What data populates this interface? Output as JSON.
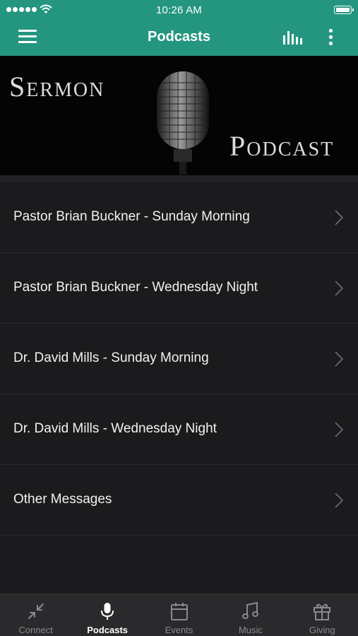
{
  "status": {
    "time": "10:26 AM"
  },
  "nav": {
    "title": "Podcasts",
    "menu_icon": "hamburger-menu-icon",
    "equalizer_icon": "equalizer-icon",
    "more_icon": "more-vertical-icon"
  },
  "banner": {
    "line1": "Sermon",
    "line2": "Podcast",
    "icon": "microphone-icon"
  },
  "podcasts": [
    {
      "label": "Pastor Brian Buckner - Sunday Morning"
    },
    {
      "label": "Pastor Brian Buckner - Wednesday Night"
    },
    {
      "label": "Dr. David Mills - Sunday Morning"
    },
    {
      "label": "Dr. David Mills - Wednesday Night"
    },
    {
      "label": "Other Messages"
    }
  ],
  "tabs": [
    {
      "label": "Connect",
      "icon": "arrows-collapse-icon",
      "active": false
    },
    {
      "label": "Podcasts",
      "icon": "microphone-icon",
      "active": true
    },
    {
      "label": "Events",
      "icon": "calendar-icon",
      "active": false
    },
    {
      "label": "Music",
      "icon": "music-note-icon",
      "active": false
    },
    {
      "label": "Giving",
      "icon": "gift-icon",
      "active": false
    }
  ],
  "colors": {
    "header": "#24967f",
    "background": "#1b1b1d",
    "tabbar": "#2a2a2c",
    "tab_inactive": "#8a8a8e",
    "tab_active": "#ffffff"
  }
}
